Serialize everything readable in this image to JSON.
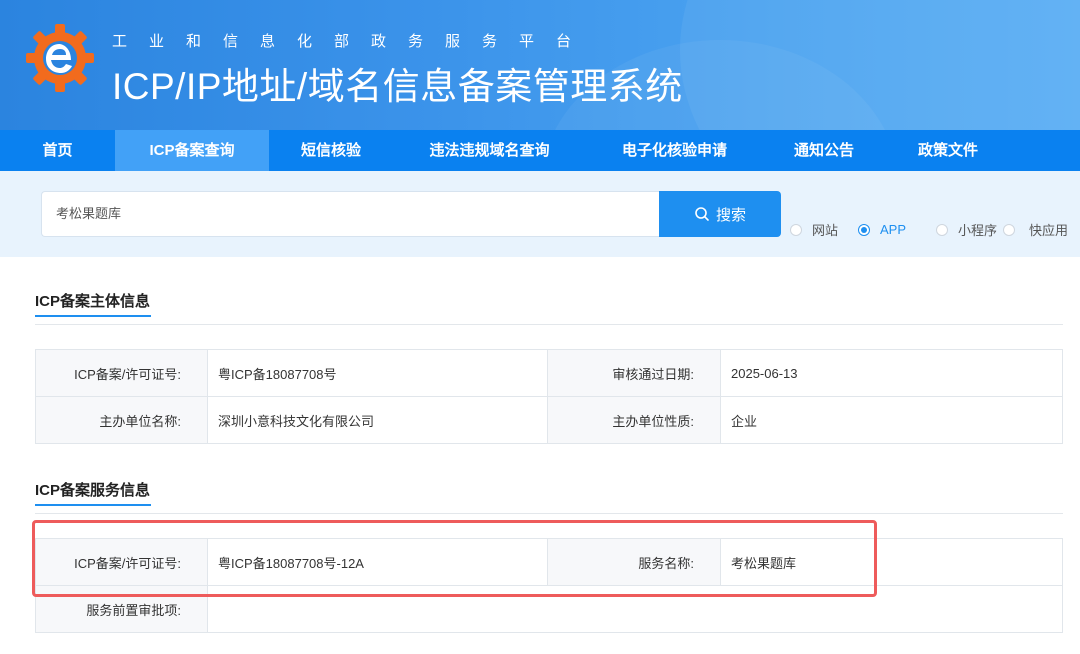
{
  "header": {
    "subtitle": "工业和信息化部政务服务平台",
    "title": "ICP/IP地址/域名信息备案管理系统"
  },
  "nav": {
    "items": [
      {
        "label": "首页"
      },
      {
        "label": "ICP备案查询"
      },
      {
        "label": "短信核验"
      },
      {
        "label": "违法违规域名查询"
      },
      {
        "label": "电子化核验申请"
      },
      {
        "label": "通知公告"
      },
      {
        "label": "政策文件"
      }
    ],
    "active_index": 1
  },
  "search": {
    "value": "考松果题库",
    "button_label": "搜索",
    "options": [
      "网站",
      "APP",
      "小程序",
      "快应用"
    ],
    "selected": "APP"
  },
  "subject_section": {
    "title": "ICP备案主体信息",
    "rows": [
      {
        "label1": "ICP备案/许可证号:",
        "value1": "粤ICP备18087708号",
        "label2": "审核通过日期:",
        "value2": "2025-06-13"
      },
      {
        "label1": "主办单位名称:",
        "value1": "深圳小意科技文化有限公司",
        "label2": "主办单位性质:",
        "value2": "企业"
      }
    ]
  },
  "service_section": {
    "title": "ICP备案服务信息",
    "rows": [
      {
        "label1": "ICP备案/许可证号:",
        "value1": "粤ICP备18087708号-12A",
        "label2": "服务名称:",
        "value2": "考松果题库"
      },
      {
        "label1": "服务前置审批项:",
        "value1": ""
      }
    ]
  },
  "colors": {
    "accent": "#1e8ff0",
    "nav_bg": "#0a81f0",
    "highlight_box": "#ee5b5b"
  }
}
